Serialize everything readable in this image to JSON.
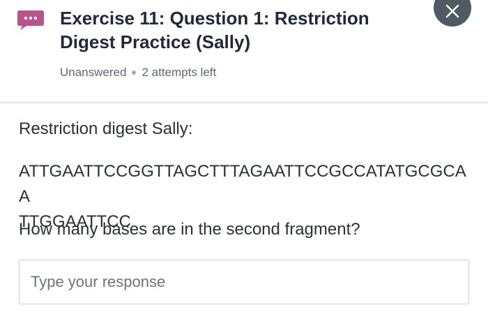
{
  "header": {
    "title": "Exercise 11: Question 1: Restriction Digest Practice (Sally)",
    "status": "Unanswered",
    "attempts": "2 attempts left",
    "chat_icon": "chat-bubble-ellipsis-icon",
    "close_icon": "close-icon",
    "accent_color": "#b9538b",
    "close_bg": "#505a63"
  },
  "content": {
    "prompt_title": "Restriction digest Sally:",
    "sequence_line1": "ATTGAATTCCGGTTAGCTTTAGAATTCCGCCATATGCGCAA",
    "sequence_line2": "TTGGAATTCC",
    "question": "How many bases are in the second fragment?"
  },
  "response": {
    "placeholder": "Type your response",
    "value": ""
  }
}
